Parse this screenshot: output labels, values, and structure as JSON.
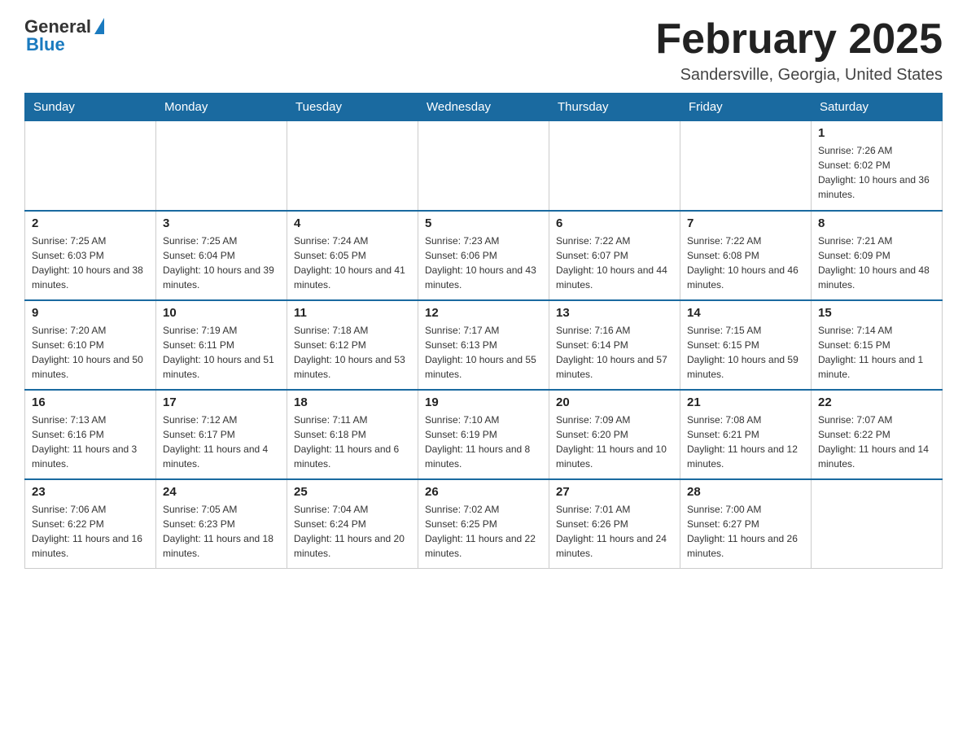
{
  "header": {
    "logo_general": "General",
    "logo_blue": "Blue",
    "title": "February 2025",
    "location": "Sandersville, Georgia, United States"
  },
  "days_of_week": [
    "Sunday",
    "Monday",
    "Tuesday",
    "Wednesday",
    "Thursday",
    "Friday",
    "Saturday"
  ],
  "weeks": [
    [
      {
        "day": "",
        "info": ""
      },
      {
        "day": "",
        "info": ""
      },
      {
        "day": "",
        "info": ""
      },
      {
        "day": "",
        "info": ""
      },
      {
        "day": "",
        "info": ""
      },
      {
        "day": "",
        "info": ""
      },
      {
        "day": "1",
        "info": "Sunrise: 7:26 AM\nSunset: 6:02 PM\nDaylight: 10 hours and 36 minutes."
      }
    ],
    [
      {
        "day": "2",
        "info": "Sunrise: 7:25 AM\nSunset: 6:03 PM\nDaylight: 10 hours and 38 minutes."
      },
      {
        "day": "3",
        "info": "Sunrise: 7:25 AM\nSunset: 6:04 PM\nDaylight: 10 hours and 39 minutes."
      },
      {
        "day": "4",
        "info": "Sunrise: 7:24 AM\nSunset: 6:05 PM\nDaylight: 10 hours and 41 minutes."
      },
      {
        "day": "5",
        "info": "Sunrise: 7:23 AM\nSunset: 6:06 PM\nDaylight: 10 hours and 43 minutes."
      },
      {
        "day": "6",
        "info": "Sunrise: 7:22 AM\nSunset: 6:07 PM\nDaylight: 10 hours and 44 minutes."
      },
      {
        "day": "7",
        "info": "Sunrise: 7:22 AM\nSunset: 6:08 PM\nDaylight: 10 hours and 46 minutes."
      },
      {
        "day": "8",
        "info": "Sunrise: 7:21 AM\nSunset: 6:09 PM\nDaylight: 10 hours and 48 minutes."
      }
    ],
    [
      {
        "day": "9",
        "info": "Sunrise: 7:20 AM\nSunset: 6:10 PM\nDaylight: 10 hours and 50 minutes."
      },
      {
        "day": "10",
        "info": "Sunrise: 7:19 AM\nSunset: 6:11 PM\nDaylight: 10 hours and 51 minutes."
      },
      {
        "day": "11",
        "info": "Sunrise: 7:18 AM\nSunset: 6:12 PM\nDaylight: 10 hours and 53 minutes."
      },
      {
        "day": "12",
        "info": "Sunrise: 7:17 AM\nSunset: 6:13 PM\nDaylight: 10 hours and 55 minutes."
      },
      {
        "day": "13",
        "info": "Sunrise: 7:16 AM\nSunset: 6:14 PM\nDaylight: 10 hours and 57 minutes."
      },
      {
        "day": "14",
        "info": "Sunrise: 7:15 AM\nSunset: 6:15 PM\nDaylight: 10 hours and 59 minutes."
      },
      {
        "day": "15",
        "info": "Sunrise: 7:14 AM\nSunset: 6:15 PM\nDaylight: 11 hours and 1 minute."
      }
    ],
    [
      {
        "day": "16",
        "info": "Sunrise: 7:13 AM\nSunset: 6:16 PM\nDaylight: 11 hours and 3 minutes."
      },
      {
        "day": "17",
        "info": "Sunrise: 7:12 AM\nSunset: 6:17 PM\nDaylight: 11 hours and 4 minutes."
      },
      {
        "day": "18",
        "info": "Sunrise: 7:11 AM\nSunset: 6:18 PM\nDaylight: 11 hours and 6 minutes."
      },
      {
        "day": "19",
        "info": "Sunrise: 7:10 AM\nSunset: 6:19 PM\nDaylight: 11 hours and 8 minutes."
      },
      {
        "day": "20",
        "info": "Sunrise: 7:09 AM\nSunset: 6:20 PM\nDaylight: 11 hours and 10 minutes."
      },
      {
        "day": "21",
        "info": "Sunrise: 7:08 AM\nSunset: 6:21 PM\nDaylight: 11 hours and 12 minutes."
      },
      {
        "day": "22",
        "info": "Sunrise: 7:07 AM\nSunset: 6:22 PM\nDaylight: 11 hours and 14 minutes."
      }
    ],
    [
      {
        "day": "23",
        "info": "Sunrise: 7:06 AM\nSunset: 6:22 PM\nDaylight: 11 hours and 16 minutes."
      },
      {
        "day": "24",
        "info": "Sunrise: 7:05 AM\nSunset: 6:23 PM\nDaylight: 11 hours and 18 minutes."
      },
      {
        "day": "25",
        "info": "Sunrise: 7:04 AM\nSunset: 6:24 PM\nDaylight: 11 hours and 20 minutes."
      },
      {
        "day": "26",
        "info": "Sunrise: 7:02 AM\nSunset: 6:25 PM\nDaylight: 11 hours and 22 minutes."
      },
      {
        "day": "27",
        "info": "Sunrise: 7:01 AM\nSunset: 6:26 PM\nDaylight: 11 hours and 24 minutes."
      },
      {
        "day": "28",
        "info": "Sunrise: 7:00 AM\nSunset: 6:27 PM\nDaylight: 11 hours and 26 minutes."
      },
      {
        "day": "",
        "info": ""
      }
    ]
  ]
}
